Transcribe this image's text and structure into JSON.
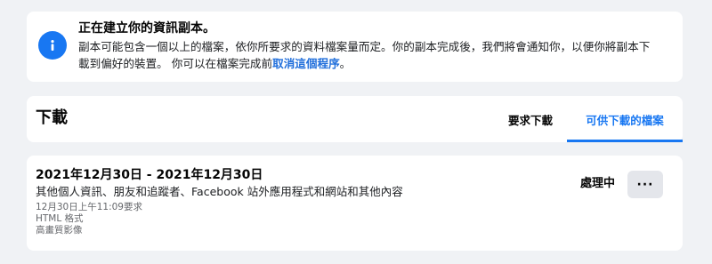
{
  "notice": {
    "title": "正在建立你的資訊副本。",
    "body_line1": "副本可能包含一個以上的檔案，依你所要求的資料檔案量而定。你的副本完成後，我們將會通知你，以便你將副本下",
    "body_line2": "載到偏好的裝置。 你可以在檔案完成前",
    "cancel_link": "取消這個程序",
    "body_end": "。",
    "icon": "info-icon"
  },
  "downloads": {
    "heading": "下載",
    "tabs": [
      {
        "label": "要求下載",
        "active": false
      },
      {
        "label": "可供下載的檔案",
        "active": true
      }
    ]
  },
  "item": {
    "date_range": "2021年12月30日 - 2021年12月30日",
    "contents": "其他個人資訊、朋友和追蹤者、Facebook 站外應用程式和網站和其他內容",
    "requested": "12月30日上午11:09要求",
    "format": "HTML 格式",
    "quality": "高畫質影像",
    "status": "處理中",
    "more_label": "···"
  },
  "colors": {
    "accent": "#1877f2",
    "background": "#f0f2f5",
    "button_bg": "#e4e6eb"
  }
}
